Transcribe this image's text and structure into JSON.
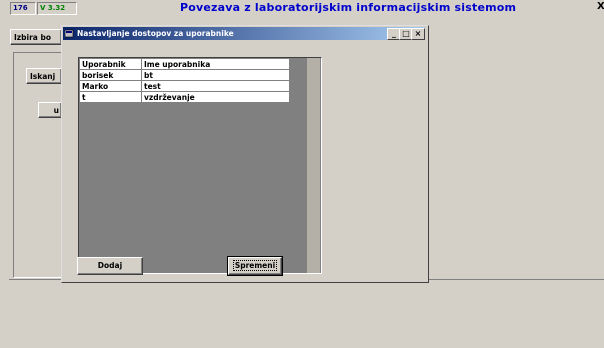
{
  "topbar": {
    "number": "176",
    "version": "V 3.32",
    "title": "Povezava z laboratorijskim informacijskim sistemom",
    "close": "X"
  },
  "background": {
    "izbira_label": "Izbira bo",
    "iskanje_label": "Iskanj",
    "u_label": "u"
  },
  "dialog": {
    "title": "Nastavljanje dostopov za uporabnike",
    "min": "_",
    "max": "□",
    "close": "×",
    "columns": [
      "Uporabnik",
      "Ime uporabnika"
    ],
    "rows": [
      [
        "borisek",
        "bt"
      ],
      [
        "Marko",
        "test"
      ],
      [
        "t",
        "vzdrževanje"
      ]
    ],
    "add_label": "Dodaj",
    "change_label": "Spremeni"
  },
  "colors": {
    "title_text": "#0000cc",
    "titlebar_start": "#0a246a",
    "titlebar_end": "#a6caf0",
    "face": "#d4d0c8"
  }
}
